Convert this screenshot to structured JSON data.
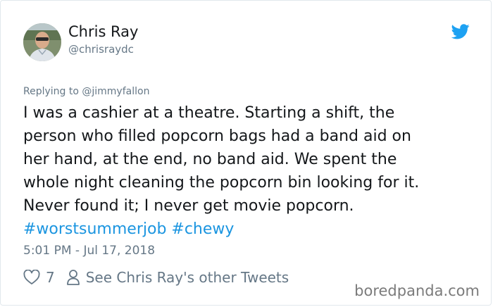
{
  "author": {
    "display_name": "Chris Ray",
    "handle": "@chrisraydc",
    "avatar_icon": "person-photo-avatar",
    "platform_icon": "twitter-bird-icon",
    "brand_color": "#1da1f2"
  },
  "reply_context": "Replying to @jimmyfallon",
  "tweet": {
    "lines": [
      "I was a cashier at a theatre. Starting a shift, the",
      "person who filled popcorn bags had a band aid on",
      "her hand, at the end, no band aid. We spent the",
      "whole night cleaning the popcorn bin looking for it.",
      "Never found it; I never get movie popcorn."
    ],
    "hashtags": [
      "#worstsummerjob",
      "#chewy"
    ],
    "hashtag_color": "#1b95e0"
  },
  "timestamp": "5:01 PM - Jul 17, 2018",
  "actions": {
    "like_icon": "heart-icon",
    "like_count": "7",
    "profile_icon": "person-outline-icon",
    "see_other": "See Chris Ray's other Tweets"
  },
  "watermark": "boredpanda.com"
}
